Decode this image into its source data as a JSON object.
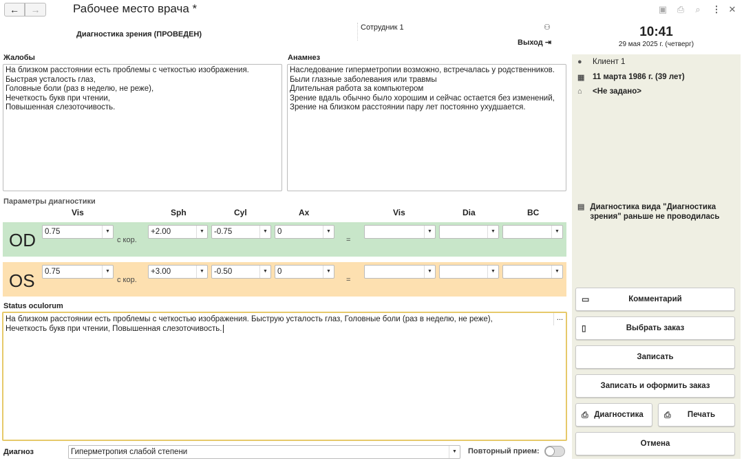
{
  "window": {
    "title": "Рабочее место врача *",
    "back": "←",
    "forward": "→"
  },
  "header": {
    "subtitle": "Диагностика зрения (ПРОВЕДЕН)",
    "employee": "Сотрудник 1",
    "exit": "Выход",
    "time": "10:41",
    "date": "29 мая 2025 г. (четверг)"
  },
  "complaints": {
    "label": "Жалобы",
    "text": "На близком расстоянии есть проблемы с четкостью изображения.\nБыстрая  усталость глаз,\nГоловные боли (раз в неделю, не реже),\nНечеткость букв при чтении,\nПовышенная слезоточивость."
  },
  "anamnesis": {
    "label": "Анамнез",
    "text": "Наследование гиперметропии возможно, встречалась у родственников.\nБыли глазные заболевания или травмы\nДлительная работа за компьютером\nЗрение вдаль обычно было хорошим и сейчас остается без изменений,\nЗрение на близком расстоянии пару лет постоянно ухудшается."
  },
  "params": {
    "label": "Параметры диагностики",
    "headers": {
      "vis": "Vis",
      "sph": "Sph",
      "cyl": "Cyl",
      "ax": "Ax",
      "vis2": "Vis",
      "dia": "Dia",
      "bc": "BC"
    },
    "correction": "с кор.",
    "equals": "="
  },
  "od": {
    "label": "OD",
    "vis": "0.75",
    "sph": "+2.00",
    "cyl": "-0.75",
    "ax": "0",
    "vis2": "",
    "dia": "",
    "bc": "",
    "color": "#c8e6c9"
  },
  "os": {
    "label": "OS",
    "vis": "0.75",
    "sph": "+3.00",
    "cyl": "-0.50",
    "ax": "0",
    "vis2": "",
    "dia": "",
    "bc": "",
    "color": "#fde0b0"
  },
  "status": {
    "label": "Status oculorum",
    "text": "На близком расстоянии есть проблемы с четкостью изображения. Быструю усталость глаз, Головные боли (раз в неделю, не реже),\nНечеткость букв при чтении, Повышенная слезоточивость.",
    "more": "..."
  },
  "diagnosis": {
    "label": "Диагноз",
    "value": "Гиперметропия слабой степени",
    "repeat_label": "Повторный прием:"
  },
  "client": {
    "name": "Клиент 1",
    "birth": "11 марта 1986 г. (39 лет)",
    "address": "<Не задано>",
    "note": "Диагностика вида \"Диагностика зрения\" раньше не проводилась"
  },
  "buttons": {
    "comment": "Комментарий",
    "select_order": "Выбрать заказ",
    "save": "Записать",
    "save_order": "Записать и оформить заказ",
    "diagnostics": "Диагностика",
    "print": "Печать",
    "cancel": "Отмена"
  },
  "colors": {
    "side_panel": "#efefe3",
    "status_border": "#e6c96a"
  }
}
